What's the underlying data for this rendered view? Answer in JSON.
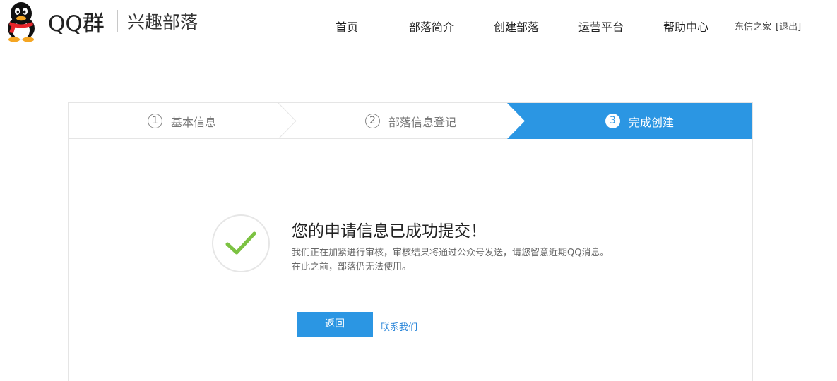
{
  "header": {
    "brand": "QQ群",
    "brand_sub": "兴趣部落",
    "nav": [
      {
        "label": "首页"
      },
      {
        "label": "部落简介"
      },
      {
        "label": "创建部落"
      },
      {
        "label": "运营平台"
      },
      {
        "label": "帮助中心"
      }
    ],
    "user_name": "东信之家",
    "logout_label": "[退出]"
  },
  "steps": [
    {
      "num": "1",
      "label": "基本信息",
      "active": false
    },
    {
      "num": "2",
      "label": "部落信息登记",
      "active": false
    },
    {
      "num": "3",
      "label": "完成创建",
      "active": true
    }
  ],
  "result": {
    "title": "您的申请信息已成功提交！",
    "line1": "我们正在加紧进行审核，审核结果将通过公众号发送，请您留意近期QQ消息。",
    "line2": "在此之前，部落仍无法使用。"
  },
  "actions": {
    "back_label": "返回",
    "contact_label": "联系我们"
  },
  "colors": {
    "accent": "#2b96e3",
    "success": "#7cc242",
    "link": "#2b86d9"
  },
  "icons": {
    "logo": "qq-penguin-logo",
    "success": "checkmark-icon"
  }
}
